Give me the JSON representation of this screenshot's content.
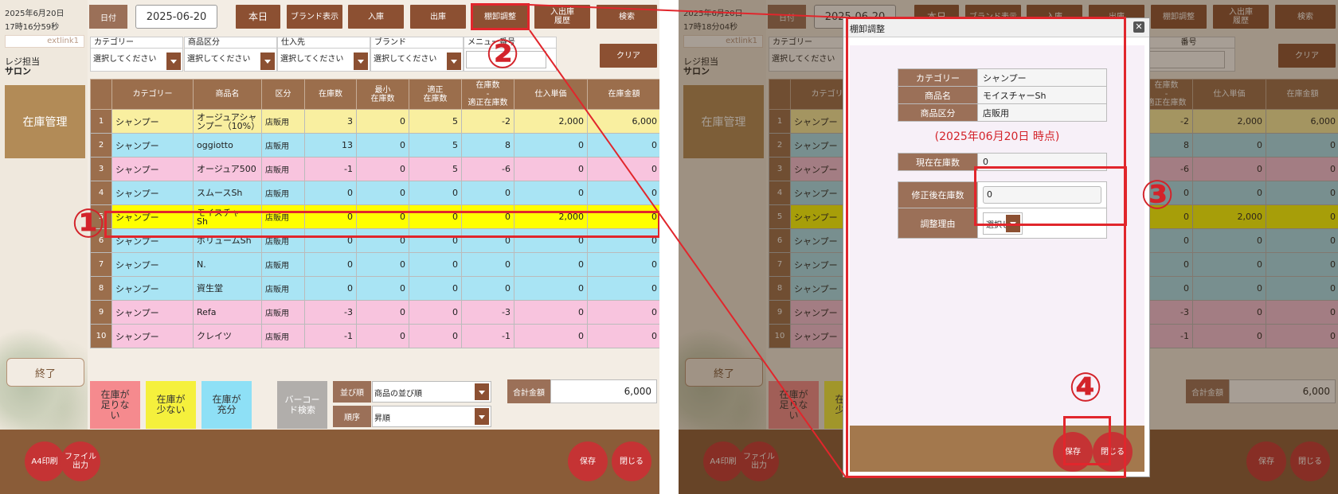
{
  "left": {
    "date_line1": "2025年6月20日",
    "date_line2": "17時16分59秒",
    "ext": "extlink1",
    "reji1": "レジ担当",
    "reji2": "サロン",
    "zaiko": "在庫管理",
    "shuryo": "終了"
  },
  "right_header": {
    "date_line1": "2025年6月20日",
    "date_line2": "17時18分04秒"
  },
  "toolbar": {
    "date_label": "日付",
    "date_value": "2025-06-20",
    "today": "本日",
    "brand": "ブランド表示",
    "nyuko": "入庫",
    "shukko": "出庫",
    "tana": "棚卸調整",
    "rireki": "入出庫\n履歴",
    "search": "検索"
  },
  "filters": {
    "category": {
      "label": "カテゴリー",
      "value": "選択してください"
    },
    "kubun": {
      "label": "商品区分",
      "value": "選択してください"
    },
    "shiire": {
      "label": "仕入先",
      "value": "選択してください"
    },
    "brand": {
      "label": "ブランド",
      "value": "選択してください"
    },
    "menu": {
      "label": "メニュー番号",
      "value": ""
    },
    "clear": "クリア",
    "menu_right": "番号"
  },
  "table": {
    "headers": [
      "カテゴリー",
      "商品名",
      "区分",
      "在庫数",
      "最小\n在庫数",
      "適正\n在庫数",
      "在庫数\n-\n適正在庫数",
      "仕入単価",
      "在庫金額"
    ],
    "rows": [
      {
        "no": "1",
        "cat": "シャンプー",
        "name": "オージュアシャンプー（10%）",
        "kubun": "店販用",
        "zaiko": "3",
        "min": "0",
        "tekisei": "5",
        "diff": "-2",
        "tanka": "2,000",
        "kingaku": "6,000",
        "color": "y"
      },
      {
        "no": "2",
        "cat": "シャンプー",
        "name": "oggiotto",
        "kubun": "店販用",
        "zaiko": "13",
        "min": "0",
        "tekisei": "5",
        "diff": "8",
        "tanka": "0",
        "kingaku": "0",
        "color": "b"
      },
      {
        "no": "3",
        "cat": "シャンプー",
        "name": "オージュア500",
        "kubun": "店販用",
        "zaiko": "-1",
        "min": "0",
        "tekisei": "5",
        "diff": "-6",
        "tanka": "0",
        "kingaku": "0",
        "color": "p"
      },
      {
        "no": "4",
        "cat": "シャンプー",
        "name": "スムースSh",
        "kubun": "店販用",
        "zaiko": "0",
        "min": "0",
        "tekisei": "0",
        "diff": "0",
        "tanka": "0",
        "kingaku": "0",
        "color": "b"
      },
      {
        "no": "5",
        "cat": "シャンプー",
        "name": "モイスチャーSh",
        "kubun": "店販用",
        "zaiko": "0",
        "min": "0",
        "tekisei": "0",
        "diff": "0",
        "tanka": "2,000",
        "kingaku": "0",
        "color": "s"
      },
      {
        "no": "6",
        "cat": "シャンプー",
        "name": "ボリュームSh",
        "kubun": "店販用",
        "zaiko": "0",
        "min": "0",
        "tekisei": "0",
        "diff": "0",
        "tanka": "0",
        "kingaku": "0",
        "color": "b"
      },
      {
        "no": "7",
        "cat": "シャンプー",
        "name": "N.",
        "kubun": "店販用",
        "zaiko": "0",
        "min": "0",
        "tekisei": "0",
        "diff": "0",
        "tanka": "0",
        "kingaku": "0",
        "color": "b"
      },
      {
        "no": "8",
        "cat": "シャンプー",
        "name": "資生堂",
        "kubun": "店販用",
        "zaiko": "0",
        "min": "0",
        "tekisei": "0",
        "diff": "0",
        "tanka": "0",
        "kingaku": "0",
        "color": "b"
      },
      {
        "no": "9",
        "cat": "シャンプー",
        "name": "Refa",
        "kubun": "店販用",
        "zaiko": "-3",
        "min": "0",
        "tekisei": "0",
        "diff": "-3",
        "tanka": "0",
        "kingaku": "0",
        "color": "p"
      },
      {
        "no": "10",
        "cat": "シャンプー",
        "name": "クレイツ",
        "kubun": "店販用",
        "zaiko": "-1",
        "min": "0",
        "tekisei": "0",
        "diff": "-1",
        "tanka": "0",
        "kingaku": "0",
        "color": "p"
      }
    ]
  },
  "legend": {
    "short": "在庫が\n足りな\nい",
    "low": "在庫が\n少ない",
    "ok": "在庫が\n充分",
    "barcode": "バーコー\nド検索"
  },
  "sort": {
    "order_label": "並び順",
    "order_value": "商品の並び順",
    "dir_label": "順序",
    "dir_value": "昇順"
  },
  "total": {
    "label": "合計金額",
    "value": "6,000"
  },
  "bottom": {
    "a4": "A4印刷",
    "file": "ファイル\n出力",
    "save": "保存",
    "close": "閉じる"
  },
  "modal": {
    "title": "棚卸調整",
    "close": "✕",
    "category_label": "カテゴリー",
    "category_value": "シャンプー",
    "name_label": "商品名",
    "name_value": "モイスチャーSh",
    "kubun_label": "商品区分",
    "kubun_value": "店販用",
    "as_of": "(2025年06月20日 時点)",
    "current_label": "現在在庫数",
    "current_value": "0",
    "after_label": "修正後在庫数",
    "after_value": "0",
    "reason_label": "調整理由",
    "reason_value": "選択し",
    "save": "保存",
    "close_btn": "閉じる"
  },
  "annotations": [
    "①",
    "②",
    "③",
    "④"
  ],
  "colors": {
    "accent_red": "#e1262c",
    "brown": "#8c5032",
    "low_stock": "#f8c4de",
    "mid_stock": "#f9efa0",
    "ok_stock": "#a9e4f4",
    "selected": "#ffff00"
  }
}
